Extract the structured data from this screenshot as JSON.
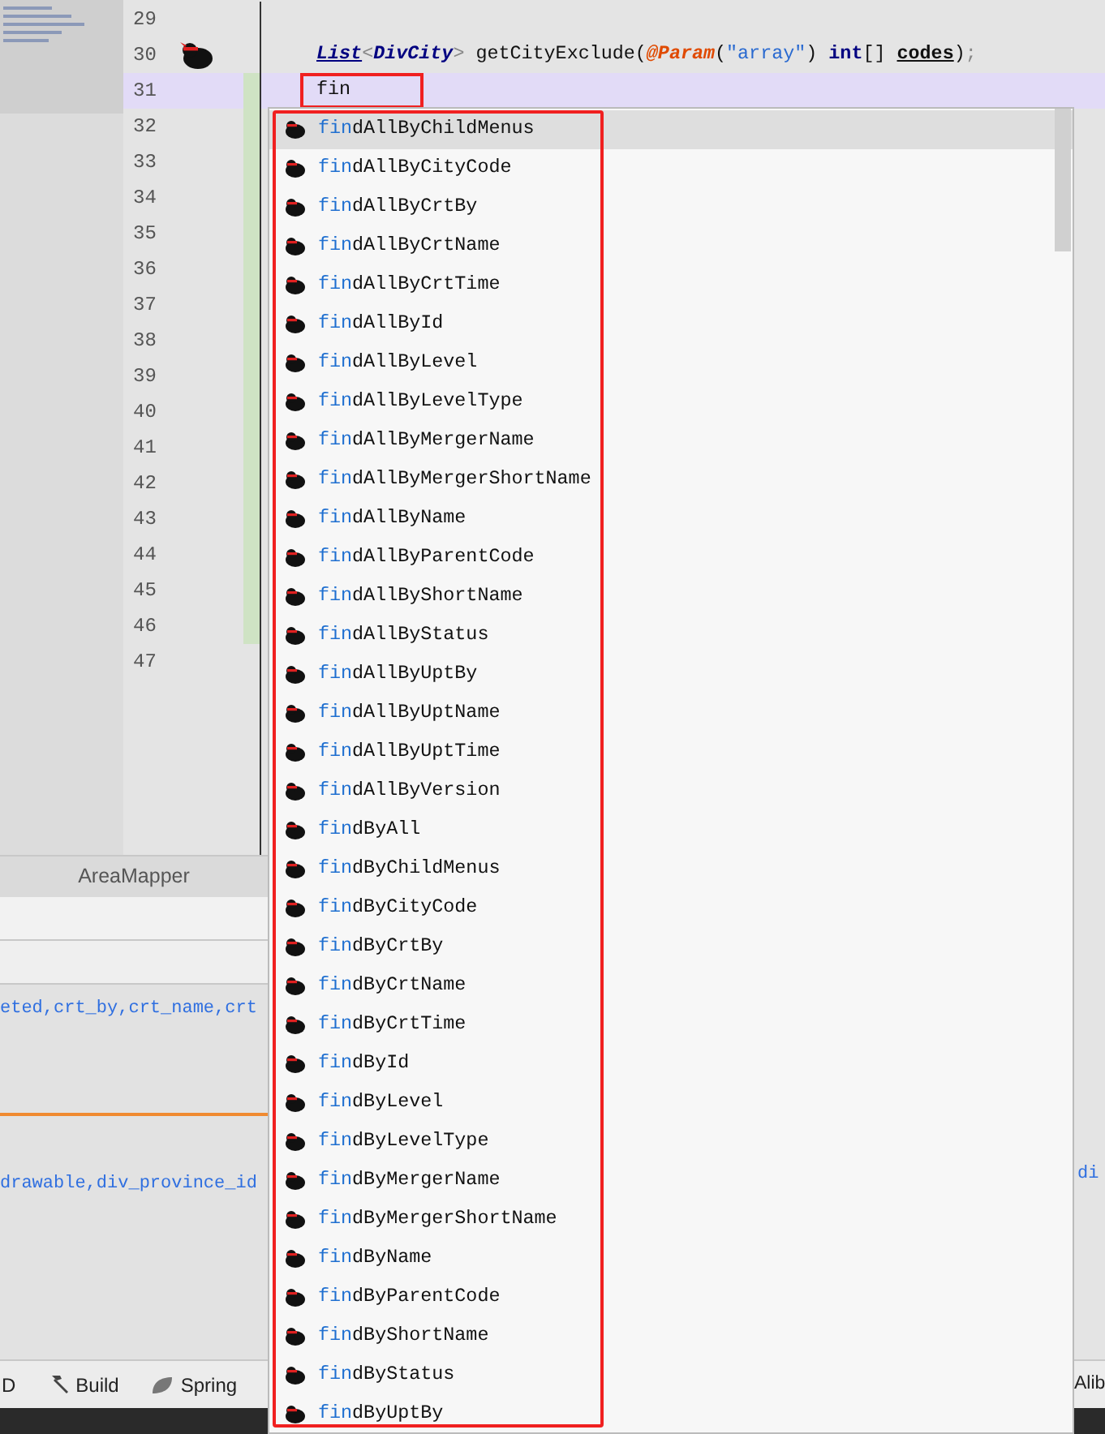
{
  "editor": {
    "lines": [
      {
        "number": "29",
        "current": false,
        "marker": false,
        "changed": false,
        "annotated": false
      },
      {
        "number": "30",
        "current": false,
        "marker": true,
        "changed": false,
        "annotated": false,
        "tokens": [
          {
            "kind": "type_underlined",
            "text": "List"
          },
          {
            "kind": "bracket",
            "text": "<"
          },
          {
            "kind": "type",
            "text": "DivCity"
          },
          {
            "kind": "bracket",
            "text": ">"
          },
          {
            "kind": "plain",
            "text": " getCityExclude("
          },
          {
            "kind": "annotation",
            "text": "@Param"
          },
          {
            "kind": "plain",
            "text": "("
          },
          {
            "kind": "string",
            "text": "\"array\""
          },
          {
            "kind": "plain",
            "text": ") "
          },
          {
            "kind": "keyword",
            "text": "int"
          },
          {
            "kind": "plain",
            "text": "[] "
          },
          {
            "kind": "param",
            "text": "codes"
          },
          {
            "kind": "plain",
            "text": ")"
          },
          {
            "kind": "punct",
            "text": ";"
          }
        ]
      },
      {
        "number": "31",
        "current": true,
        "marker": false,
        "changed": true,
        "annotated": true,
        "tokens": [
          {
            "kind": "plain",
            "text": "fin"
          }
        ]
      },
      {
        "number": "32",
        "current": false,
        "marker": false,
        "changed": true,
        "annotated": false
      },
      {
        "number": "33",
        "current": false,
        "marker": false,
        "changed": true,
        "annotated": false
      },
      {
        "number": "34",
        "current": false,
        "marker": false,
        "changed": true,
        "annotated": false
      },
      {
        "number": "35",
        "current": false,
        "marker": false,
        "changed": true,
        "annotated": false
      },
      {
        "number": "36",
        "current": false,
        "marker": false,
        "changed": true,
        "annotated": false
      },
      {
        "number": "37",
        "current": false,
        "marker": false,
        "changed": true,
        "annotated": false
      },
      {
        "number": "38",
        "current": false,
        "marker": false,
        "changed": true,
        "annotated": false
      },
      {
        "number": "39",
        "current": false,
        "marker": false,
        "changed": true,
        "annotated": false
      },
      {
        "number": "40",
        "current": false,
        "marker": false,
        "changed": true,
        "annotated": false
      },
      {
        "number": "41",
        "current": false,
        "marker": false,
        "changed": true,
        "annotated": false
      },
      {
        "number": "42",
        "current": false,
        "marker": false,
        "changed": true,
        "annotated": false
      },
      {
        "number": "43",
        "current": false,
        "marker": false,
        "changed": true,
        "annotated": false
      },
      {
        "number": "44",
        "current": false,
        "marker": false,
        "changed": true,
        "annotated": false
      },
      {
        "number": "45",
        "current": false,
        "marker": false,
        "changed": true,
        "annotated": false
      },
      {
        "number": "46",
        "current": false,
        "marker": false,
        "changed": true,
        "annotated": false
      },
      {
        "number": "47",
        "current": false,
        "marker": false,
        "changed": false
      }
    ]
  },
  "completion_popup": {
    "annotated": true,
    "items": [
      {
        "typed": "fin",
        "completion": "dAllByChildMenus",
        "selected": true
      },
      {
        "typed": "fin",
        "completion": "dAllByCityCode",
        "selected": false
      },
      {
        "typed": "fin",
        "completion": "dAllByCrtBy",
        "selected": false
      },
      {
        "typed": "fin",
        "completion": "dAllByCrtName",
        "selected": false
      },
      {
        "typed": "fin",
        "completion": "dAllByCrtTime",
        "selected": false
      },
      {
        "typed": "fin",
        "completion": "dAllById",
        "selected": false
      },
      {
        "typed": "fin",
        "completion": "dAllByLevel",
        "selected": false
      },
      {
        "typed": "fin",
        "completion": "dAllByLevelType",
        "selected": false
      },
      {
        "typed": "fin",
        "completion": "dAllByMergerName",
        "selected": false
      },
      {
        "typed": "fin",
        "completion": "dAllByMergerShortName",
        "selected": false
      },
      {
        "typed": "fin",
        "completion": "dAllByName",
        "selected": false
      },
      {
        "typed": "fin",
        "completion": "dAllByParentCode",
        "selected": false
      },
      {
        "typed": "fin",
        "completion": "dAllByShortName",
        "selected": false
      },
      {
        "typed": "fin",
        "completion": "dAllByStatus",
        "selected": false
      },
      {
        "typed": "fin",
        "completion": "dAllByUptBy",
        "selected": false
      },
      {
        "typed": "fin",
        "completion": "dAllByUptName",
        "selected": false
      },
      {
        "typed": "fin",
        "completion": "dAllByUptTime",
        "selected": false
      },
      {
        "typed": "fin",
        "completion": "dAllByVersion",
        "selected": false
      },
      {
        "typed": "fin",
        "completion": "dByAll",
        "selected": false
      },
      {
        "typed": "fin",
        "completion": "dByChildMenus",
        "selected": false
      },
      {
        "typed": "fin",
        "completion": "dByCityCode",
        "selected": false
      },
      {
        "typed": "fin",
        "completion": "dByCrtBy",
        "selected": false
      },
      {
        "typed": "fin",
        "completion": "dByCrtName",
        "selected": false
      },
      {
        "typed": "fin",
        "completion": "dByCrtTime",
        "selected": false
      },
      {
        "typed": "fin",
        "completion": "dById",
        "selected": false
      },
      {
        "typed": "fin",
        "completion": "dByLevel",
        "selected": false
      },
      {
        "typed": "fin",
        "completion": "dByLevelType",
        "selected": false
      },
      {
        "typed": "fin",
        "completion": "dByMergerName",
        "selected": false
      },
      {
        "typed": "fin",
        "completion": "dByMergerShortName",
        "selected": false
      },
      {
        "typed": "fin",
        "completion": "dByName",
        "selected": false
      },
      {
        "typed": "fin",
        "completion": "dByParentCode",
        "selected": false
      },
      {
        "typed": "fin",
        "completion": "dByShortName",
        "selected": false
      },
      {
        "typed": "fin",
        "completion": "dByStatus",
        "selected": false
      },
      {
        "typed": "fin",
        "completion": "dByUptBy",
        "selected": false
      }
    ]
  },
  "tool_window": {
    "title": "AreaMapper",
    "rows": [
      {
        "text": "eted,crt_by,crt_name,crt",
        "right_text": null
      },
      {
        "text": "drawable,div_province_id",
        "right_text": "di"
      }
    ]
  },
  "bottom_toolbar": {
    "items": [
      {
        "label": "D",
        "kind": "text"
      },
      {
        "label": "Build",
        "kind": "build"
      },
      {
        "label": "Spring",
        "kind": "spring"
      }
    ],
    "right_label": "Alib"
  }
}
